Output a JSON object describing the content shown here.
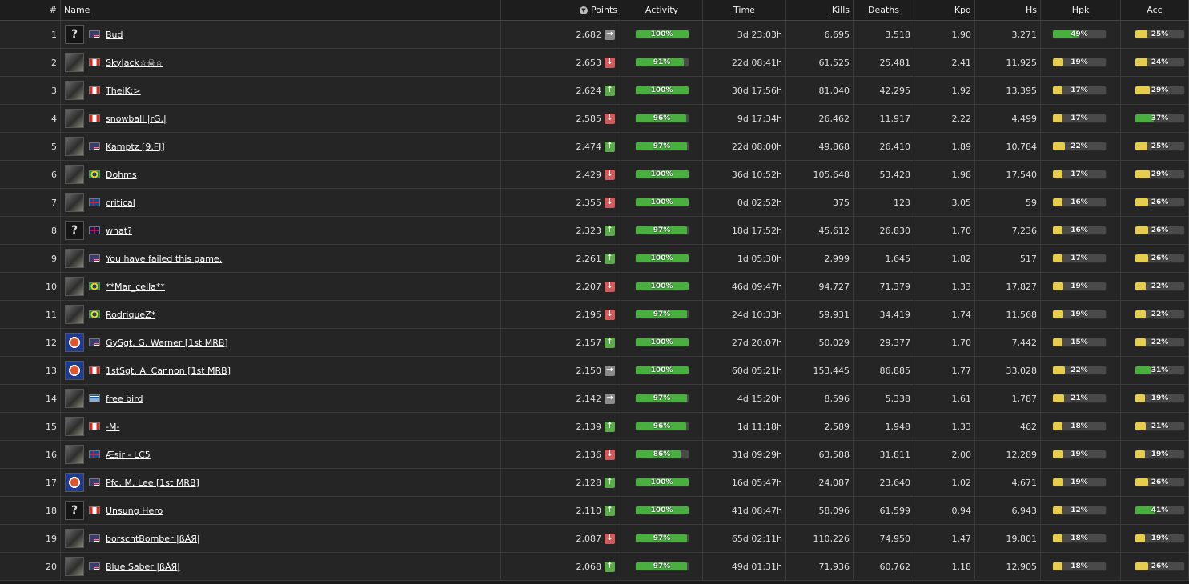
{
  "columns": {
    "rank": "#",
    "name": "Name",
    "points": "Points",
    "activity": "Activity",
    "time": "Time",
    "kills": "Kills",
    "deaths": "Deaths",
    "kpd": "Kpd",
    "hs": "Hs",
    "hpk": "Hpk",
    "acc": "Acc"
  },
  "colors": {
    "trend_up": "#5bab4a",
    "trend_down": "#d35a5a",
    "trend_same": "#8a8a8a",
    "bar_green": "#49b040",
    "bar_yellow": "#e6cc4f"
  },
  "rows": [
    {
      "rank": "1",
      "name": "Bud",
      "flag": "us",
      "avatar": "unknown",
      "points": "2,682",
      "trend": "same",
      "activity": "100%",
      "time": "3d 23:03h",
      "kills": "6,695",
      "deaths": "3,518",
      "kpd": "1.90",
      "hs": "3,271",
      "hpk": "49%",
      "acc": "25%"
    },
    {
      "rank": "2",
      "name": "SkyJack☆☠☆",
      "flag": "ca",
      "avatar": "photo",
      "points": "2,653",
      "trend": "down",
      "activity": "91%",
      "time": "22d 08:41h",
      "kills": "61,525",
      "deaths": "25,481",
      "kpd": "2.41",
      "hs": "11,925",
      "hpk": "19%",
      "acc": "24%"
    },
    {
      "rank": "3",
      "name": "TheiK:>",
      "flag": "ca",
      "avatar": "photo",
      "points": "2,624",
      "trend": "up",
      "activity": "100%",
      "time": "30d 17:56h",
      "kills": "81,040",
      "deaths": "42,295",
      "kpd": "1.92",
      "hs": "13,395",
      "hpk": "17%",
      "acc": "29%"
    },
    {
      "rank": "4",
      "name": "snowball |rG.|",
      "flag": "ca",
      "avatar": "photo",
      "points": "2,585",
      "trend": "down",
      "activity": "96%",
      "time": "9d 17:34h",
      "kills": "26,462",
      "deaths": "11,917",
      "kpd": "2.22",
      "hs": "4,499",
      "hpk": "17%",
      "acc": "37%"
    },
    {
      "rank": "5",
      "name": "Kamptz [9.FJ]",
      "flag": "us",
      "avatar": "photo",
      "points": "2,474",
      "trend": "up",
      "activity": "97%",
      "time": "22d 08:00h",
      "kills": "49,868",
      "deaths": "26,410",
      "kpd": "1.89",
      "hs": "10,784",
      "hpk": "22%",
      "acc": "25%"
    },
    {
      "rank": "6",
      "name": "Dohms",
      "flag": "br",
      "avatar": "photo",
      "points": "2,429",
      "trend": "down",
      "activity": "100%",
      "time": "36d 10:52h",
      "kills": "105,648",
      "deaths": "53,428",
      "kpd": "1.98",
      "hs": "17,540",
      "hpk": "17%",
      "acc": "29%"
    },
    {
      "rank": "7",
      "name": "critical",
      "flag": "is",
      "avatar": "photo",
      "points": "2,355",
      "trend": "down",
      "activity": "100%",
      "time": "0d 02:52h",
      "kills": "375",
      "deaths": "123",
      "kpd": "3.05",
      "hs": "59",
      "hpk": "16%",
      "acc": "26%"
    },
    {
      "rank": "8",
      "name": "what?",
      "flag": "gb",
      "avatar": "unknown",
      "points": "2,323",
      "trend": "up",
      "activity": "97%",
      "time": "18d 17:52h",
      "kills": "45,612",
      "deaths": "26,830",
      "kpd": "1.70",
      "hs": "7,236",
      "hpk": "16%",
      "acc": "26%"
    },
    {
      "rank": "9",
      "name": "You have failed this game.",
      "flag": "us",
      "avatar": "photo",
      "points": "2,261",
      "trend": "up",
      "activity": "100%",
      "time": "1d 05:30h",
      "kills": "2,999",
      "deaths": "1,645",
      "kpd": "1.82",
      "hs": "517",
      "hpk": "17%",
      "acc": "26%"
    },
    {
      "rank": "10",
      "name": "**Mar_cella**",
      "flag": "br",
      "avatar": "photo",
      "points": "2,207",
      "trend": "down",
      "activity": "100%",
      "time": "46d 09:47h",
      "kills": "94,727",
      "deaths": "71,379",
      "kpd": "1.33",
      "hs": "17,827",
      "hpk": "19%",
      "acc": "22%"
    },
    {
      "rank": "11",
      "name": "RodriqueZ*",
      "flag": "br",
      "avatar": "photo",
      "points": "2,195",
      "trend": "down",
      "activity": "97%",
      "time": "24d 10:33h",
      "kills": "59,931",
      "deaths": "34,419",
      "kpd": "1.74",
      "hs": "11,568",
      "hpk": "19%",
      "acc": "22%"
    },
    {
      "rank": "12",
      "name": "GySgt. G. Werner [1st MRB]",
      "flag": "us",
      "avatar": "emblem",
      "points": "2,157",
      "trend": "up",
      "activity": "100%",
      "time": "27d 20:07h",
      "kills": "50,029",
      "deaths": "29,377",
      "kpd": "1.70",
      "hs": "7,442",
      "hpk": "15%",
      "acc": "22%"
    },
    {
      "rank": "13",
      "name": "1stSgt. A. Cannon [1st MRB]",
      "flag": "ca",
      "avatar": "emblem",
      "points": "2,150",
      "trend": "same",
      "activity": "100%",
      "time": "60d 05:21h",
      "kills": "153,445",
      "deaths": "86,885",
      "kpd": "1.77",
      "hs": "33,028",
      "hpk": "22%",
      "acc": "31%"
    },
    {
      "rank": "14",
      "name": "free bird",
      "flag": "gr",
      "avatar": "photo",
      "points": "2,142",
      "trend": "same",
      "activity": "97%",
      "time": "4d 15:20h",
      "kills": "8,596",
      "deaths": "5,338",
      "kpd": "1.61",
      "hs": "1,787",
      "hpk": "21%",
      "acc": "19%"
    },
    {
      "rank": "15",
      "name": "-M-",
      "flag": "ca",
      "avatar": "photo",
      "points": "2,139",
      "trend": "up",
      "activity": "96%",
      "time": "1d 11:18h",
      "kills": "2,589",
      "deaths": "1,948",
      "kpd": "1.33",
      "hs": "462",
      "hpk": "18%",
      "acc": "21%"
    },
    {
      "rank": "16",
      "name": "Æsir - LC5",
      "flag": "is",
      "avatar": "photo",
      "points": "2,136",
      "trend": "down",
      "activity": "86%",
      "time": "31d 09:29h",
      "kills": "63,588",
      "deaths": "31,811",
      "kpd": "2.00",
      "hs": "12,289",
      "hpk": "19%",
      "acc": "19%"
    },
    {
      "rank": "17",
      "name": "Pfc. M. Lee [1st MRB]",
      "flag": "us",
      "avatar": "emblem",
      "points": "2,128",
      "trend": "up",
      "activity": "100%",
      "time": "16d 05:47h",
      "kills": "24,087",
      "deaths": "23,640",
      "kpd": "1.02",
      "hs": "4,671",
      "hpk": "19%",
      "acc": "26%"
    },
    {
      "rank": "18",
      "name": "Unsung Hero",
      "flag": "ca",
      "avatar": "unknown",
      "points": "2,110",
      "trend": "up",
      "activity": "100%",
      "time": "41d 08:47h",
      "kills": "58,096",
      "deaths": "61,599",
      "kpd": "0.94",
      "hs": "6,943",
      "hpk": "12%",
      "acc": "41%"
    },
    {
      "rank": "19",
      "name": "borschtBomber |ßÄЯ|",
      "flag": "us",
      "avatar": "photo",
      "points": "2,087",
      "trend": "down",
      "activity": "97%",
      "time": "65d 02:11h",
      "kills": "110,226",
      "deaths": "74,950",
      "kpd": "1.47",
      "hs": "19,801",
      "hpk": "18%",
      "acc": "19%"
    },
    {
      "rank": "20",
      "name": "Blue Saber |ßÄЯ|",
      "flag": "us",
      "avatar": "photo",
      "points": "2,068",
      "trend": "up",
      "activity": "97%",
      "time": "49d 01:31h",
      "kills": "71,936",
      "deaths": "60,762",
      "kpd": "1.18",
      "hs": "12,905",
      "hpk": "18%",
      "acc": "26%"
    }
  ]
}
